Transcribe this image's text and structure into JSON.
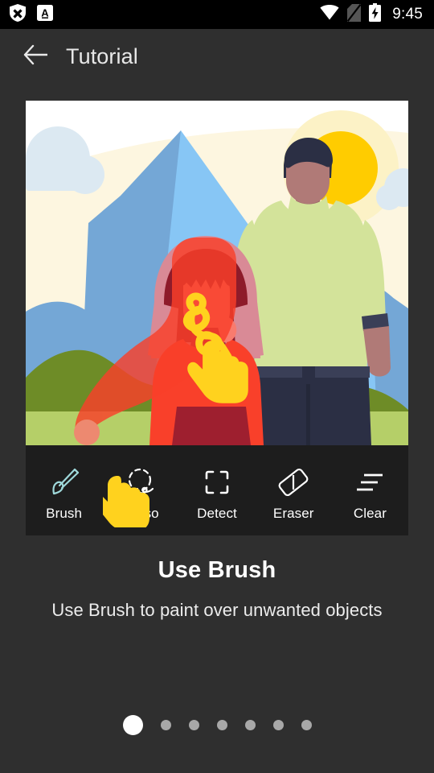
{
  "status_bar": {
    "icons_left": [
      "shield-x-icon",
      "letter-a-box-icon"
    ],
    "icons_right": [
      "wifi-icon",
      "sim-card-off-icon",
      "battery-charging-icon"
    ],
    "time": "9:45"
  },
  "app_bar": {
    "back_icon": "arrow-back-icon",
    "title": "Tutorial"
  },
  "illustration": {
    "alt": "Two people standing in front of a mountain with a red brush stroke painted over the woman",
    "colors": {
      "sky": "#ffffff",
      "sky_band": "#fdf6e0",
      "sun": "#ffcc00",
      "sun_halo": "#fdf3c9",
      "cloud": "#dde9f2",
      "mountain_light": "#87c6f5",
      "mountain_dark": "#74a7d6",
      "hill_dark": "#6e8c27",
      "grass": "#b5cf68",
      "hood": "#d98a96",
      "hair": "#8e1b2a",
      "skin_woman": "#f97b6e",
      "coat": "#f9402a",
      "skirt": "#9e1f2f",
      "brush_stroke": "#f9402a",
      "brush_tip": "#fa7a72",
      "man_hair": "#2b2f44",
      "man_skin": "#b07a77",
      "man_sweater": "#d3e39a",
      "man_pants": "#2b2f44",
      "cursor": "#ffd21e",
      "trail": "#ffd21e"
    }
  },
  "toolbar": {
    "tools": [
      {
        "label": "Brush",
        "icon": "brush-icon",
        "active": true
      },
      {
        "label": "Lasso",
        "icon": "lasso-icon",
        "active": false
      },
      {
        "label": "Detect",
        "icon": "detect-icon",
        "active": false
      },
      {
        "label": "Eraser",
        "icon": "eraser-icon",
        "active": false
      },
      {
        "label": "Clear",
        "icon": "clear-icon",
        "active": false
      }
    ],
    "cursor_icon": "pointing-hand-cursor",
    "cursor_over": "Brush"
  },
  "tutorial": {
    "title": "Use Brush",
    "subtitle": "Use Brush to paint over unwanted objects"
  },
  "pagination": {
    "total": 7,
    "active_index": 0,
    "dots": [
      {
        "active": true
      },
      {
        "active": false
      },
      {
        "active": false
      },
      {
        "active": false
      },
      {
        "active": false
      },
      {
        "active": false
      },
      {
        "active": false
      }
    ]
  }
}
